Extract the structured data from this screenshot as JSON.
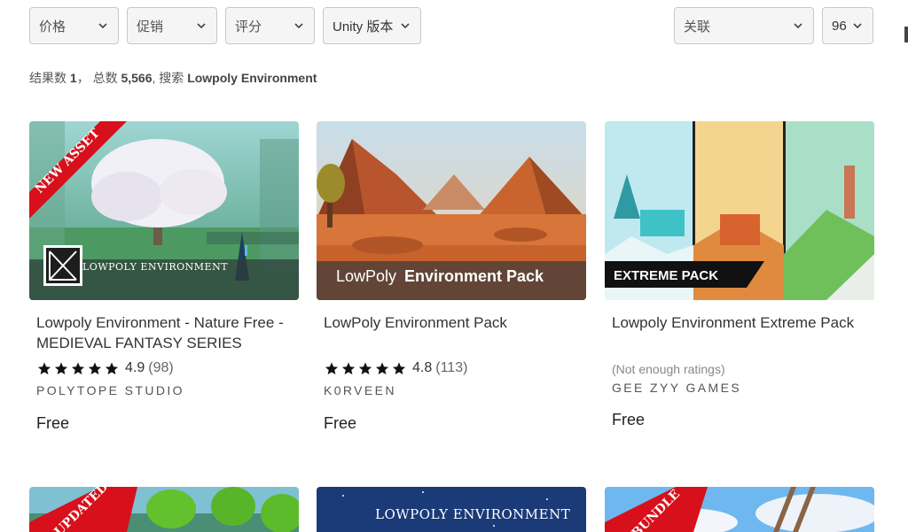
{
  "filters": {
    "price": "价格",
    "promo": "促销",
    "rating": "评分",
    "unity_version": "Unity 版本",
    "sort": "关联",
    "per_page": "96"
  },
  "results": {
    "prefix": "结果数",
    "page": "1",
    "sep": "，",
    "total_label": "总数",
    "total": "5,566",
    "search_label": "搜索",
    "query": "Lowpoly Environment"
  },
  "cards": [
    {
      "title": "Lowpoly Environment - Nature Free - MEDIEVAL FANTASY SERIES",
      "badge": "NEW ASSET",
      "overlay": "LOWPOLY ENVIRONMENT",
      "rating": "4.9",
      "rating_count": "(98)",
      "stars": 5,
      "publisher": "POLYTOPE STUDIO",
      "price": "Free"
    },
    {
      "title": "LowPoly Environment Pack",
      "overlay_light": "LowPoly",
      "overlay_bold": "Environment Pack",
      "rating": "4.8",
      "rating_count": "(113)",
      "stars": 5,
      "publisher": "K0RVEEN",
      "price": "Free"
    },
    {
      "title": "Lowpoly Environment Extreme Pack",
      "overlay": "EXTREME PACK",
      "no_rating": "(Not enough ratings)",
      "publisher": "GEE ZYY GAMES",
      "price": "Free"
    }
  ],
  "row2": [
    {
      "badge": "UPDATED"
    },
    {
      "overlay": "LOWPOLY ENVIRONMENT"
    },
    {
      "badge": "BUNDLE"
    }
  ],
  "colors": {
    "badge_red": "#d7101b",
    "star": "#111111",
    "filter_bg": "#f5f5f5"
  }
}
